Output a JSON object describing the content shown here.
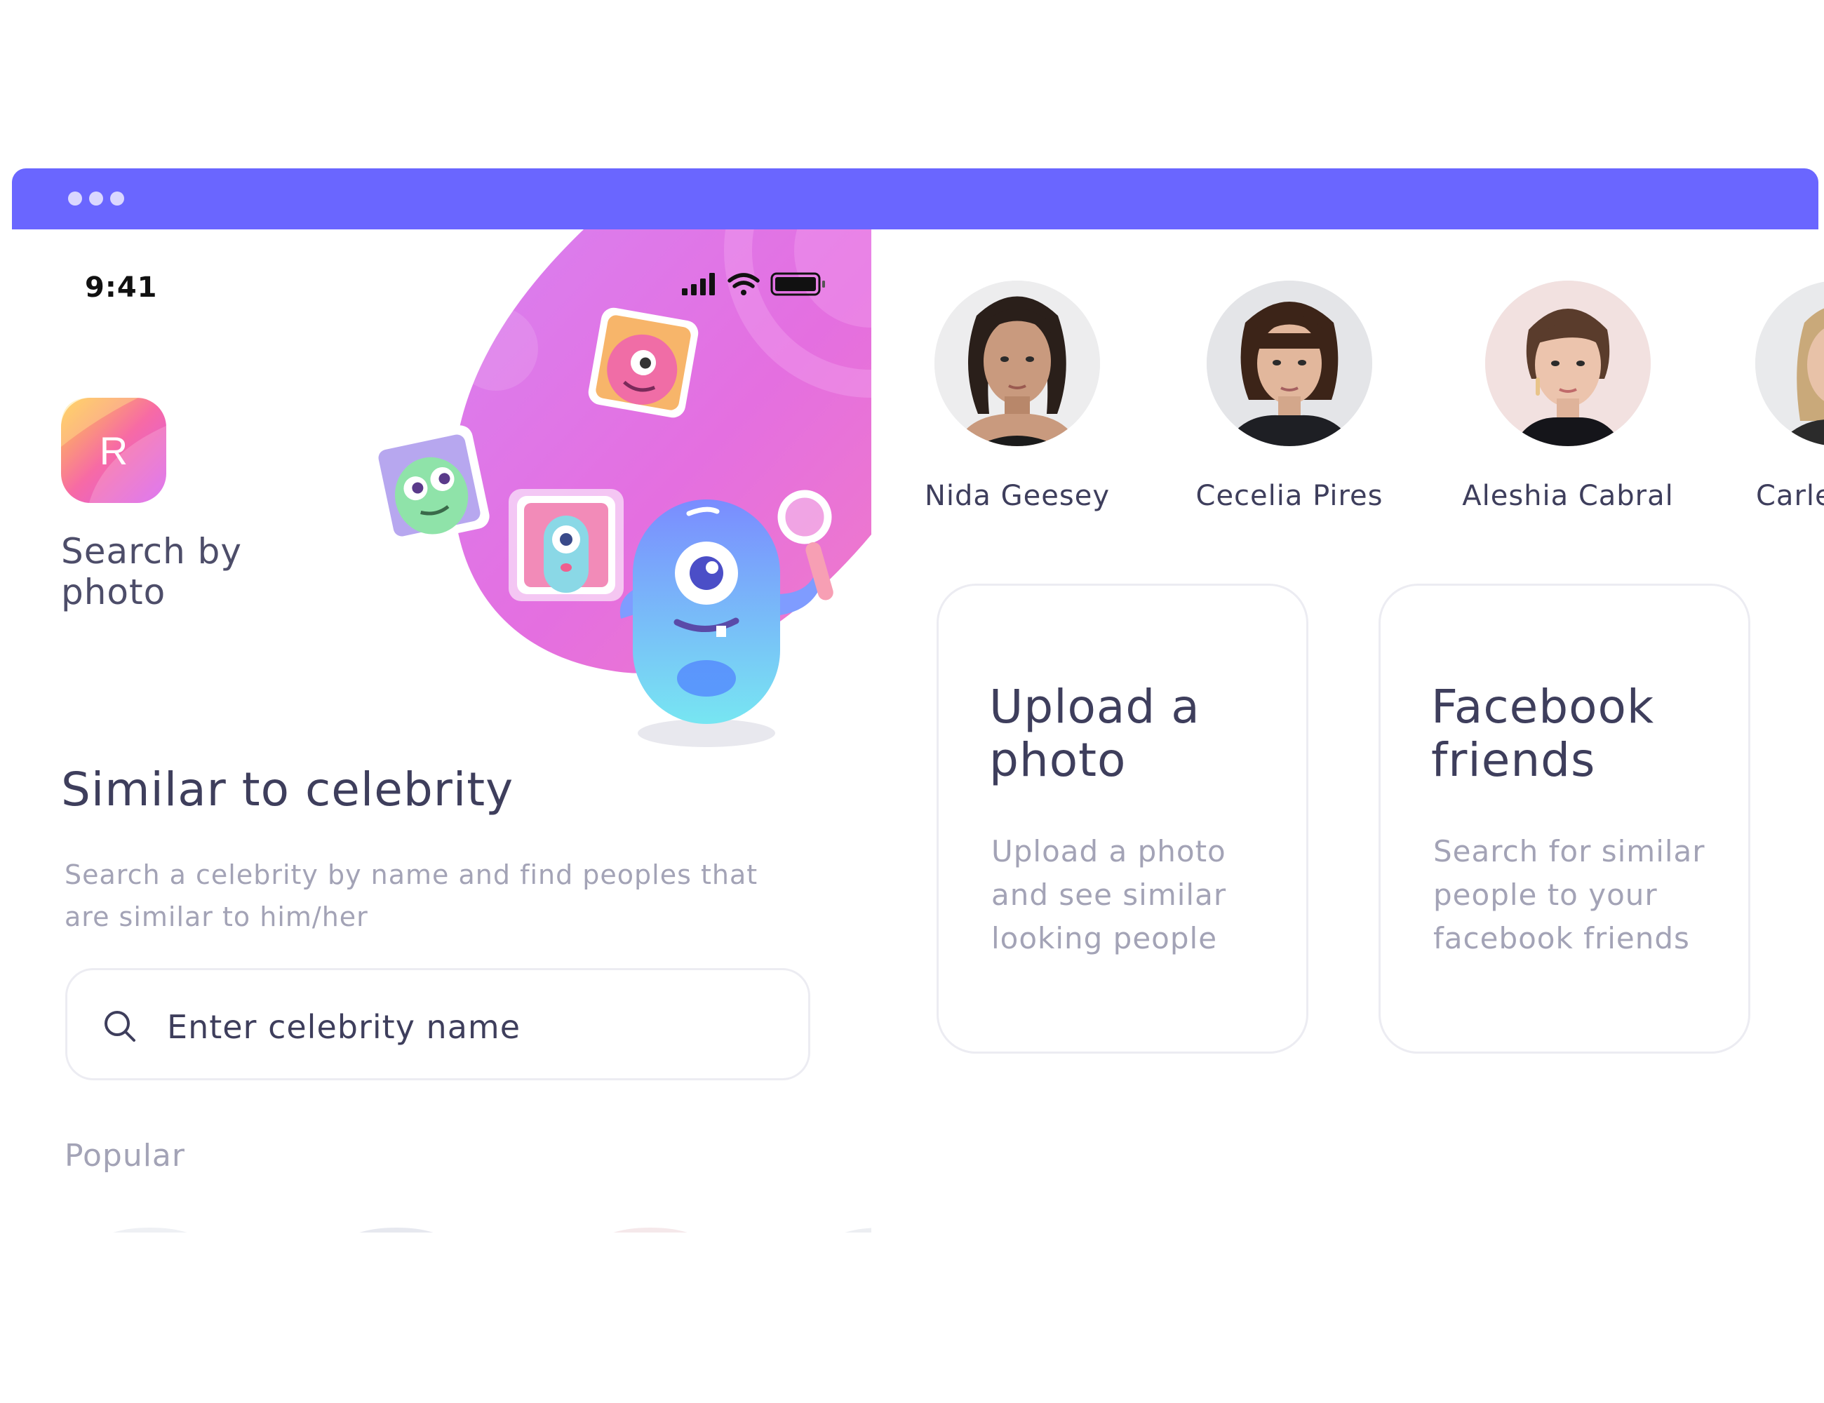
{
  "colors": {
    "topbar": "#6a66ff",
    "heading_text": "#3e3e5c",
    "muted_text": "#a3a3b6",
    "card_border": "#ececf2",
    "blob_pink": "#e46fe0"
  },
  "window": {
    "dots": [
      "dot",
      "dot",
      "dot"
    ]
  },
  "status_bar": {
    "time": "9:41",
    "icons": [
      "cellular-signal-icon",
      "wifi-icon",
      "battery-icon"
    ]
  },
  "app": {
    "logo_letter": "R",
    "title": "Search by photo"
  },
  "celebrity_section": {
    "title": "Similar to celebrity",
    "description": "Search a celebrity by name and find peoples that are similar to him/her",
    "search_placeholder": "Enter celebrity name",
    "popular_label": "Popular"
  },
  "popular": [
    {
      "name": "Nida Geesey"
    },
    {
      "name": "Cecelia Pires"
    },
    {
      "name": "Aleshia Cabral"
    },
    {
      "name": "Carle"
    }
  ],
  "features": [
    {
      "title": "Upload a photo",
      "description": "Upload a photo and see similar looking people"
    },
    {
      "title": "Facebook friends",
      "description": "Search for similar people to your facebook friends"
    }
  ]
}
